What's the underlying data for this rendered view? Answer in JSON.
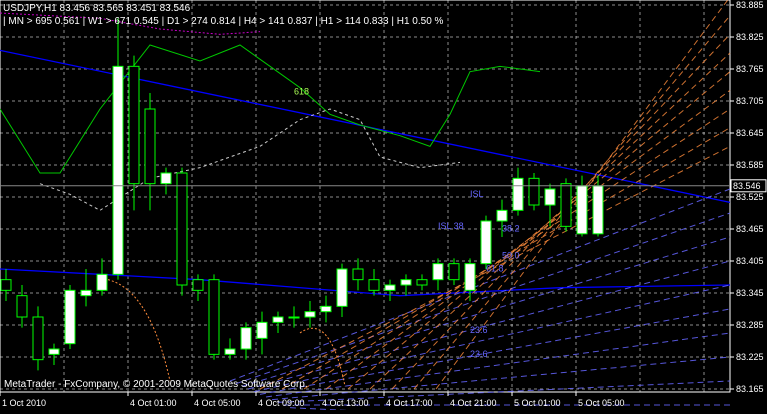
{
  "header": {
    "symbol_line": "USDJPY,H1  83.456 83.565 83.451 83.546",
    "mtf_line": "| MN > 695  0.561 | W1 > 671  0.545 | D1 > 274  0.814 | H4 > 141  0.837 | H1 > 114  0.833 | H1  0.50 %"
  },
  "footer": {
    "copyright": "MetaTrader - FxCompany, © 2001-2009 MetaQuotes Software Corp."
  },
  "colors": {
    "background": "#000000",
    "grid": "#ffffff",
    "bull_body": "#ffffff",
    "candle_outline": "#00ff00",
    "trend_blue": "#0000ff",
    "fan_blue": "#6666ff",
    "fan_orange": "#ff8c3c",
    "green_line": "#00c800",
    "white_dashed": "#ffffff",
    "magenta": "#c800c8",
    "price_label_bg": "#000000"
  },
  "chart_data": {
    "type": "candlestick",
    "symbol": "USDJPY",
    "timeframe": "H1",
    "y_ticks": [
      "83.885",
      "83.825",
      "83.765",
      "83.705",
      "83.645",
      "83.585",
      "83.525",
      "83.465",
      "83.405",
      "83.345",
      "83.285",
      "83.225",
      "83.165"
    ],
    "ylim": [
      83.165,
      83.885
    ],
    "current_price": "83.546",
    "x_ticks": [
      {
        "label": "1 Oct 2010",
        "i": 0
      },
      {
        "label": "4 Oct 01:00",
        "i": 8
      },
      {
        "label": "4 Oct 05:00",
        "i": 12
      },
      {
        "label": "4 Oct 09:00",
        "i": 16
      },
      {
        "label": "4 Oct 13:00",
        "i": 20
      },
      {
        "label": "4 Oct 17:00",
        "i": 24
      },
      {
        "label": "4 Oct 21:00",
        "i": 28
      },
      {
        "label": "5 Oct 01:00",
        "i": 32
      },
      {
        "label": "5 Oct 05:00",
        "i": 36
      }
    ],
    "candles": [
      {
        "o": 83.37,
        "h": 83.39,
        "l": 83.33,
        "c": 83.35
      },
      {
        "o": 83.34,
        "h": 83.36,
        "l": 83.28,
        "c": 83.3
      },
      {
        "o": 83.3,
        "h": 83.32,
        "l": 83.2,
        "c": 83.22
      },
      {
        "o": 83.23,
        "h": 83.25,
        "l": 83.21,
        "c": 83.24
      },
      {
        "o": 83.25,
        "h": 83.36,
        "l": 83.24,
        "c": 83.35
      },
      {
        "o": 83.34,
        "h": 83.39,
        "l": 83.32,
        "c": 83.35
      },
      {
        "o": 83.35,
        "h": 83.41,
        "l": 83.34,
        "c": 83.38
      },
      {
        "o": 83.38,
        "h": 83.86,
        "l": 83.37,
        "c": 83.77
      },
      {
        "o": 83.77,
        "h": 83.79,
        "l": 83.5,
        "c": 83.55
      },
      {
        "o": 83.69,
        "h": 83.72,
        "l": 83.5,
        "c": 83.55
      },
      {
        "o": 83.55,
        "h": 83.58,
        "l": 83.53,
        "c": 83.57
      },
      {
        "o": 83.57,
        "h": 83.58,
        "l": 83.34,
        "c": 83.36
      },
      {
        "o": 83.37,
        "h": 83.38,
        "l": 83.33,
        "c": 83.35
      },
      {
        "o": 83.37,
        "h": 83.38,
        "l": 83.22,
        "c": 83.23
      },
      {
        "o": 83.23,
        "h": 83.26,
        "l": 83.22,
        "c": 83.24
      },
      {
        "o": 83.24,
        "h": 83.29,
        "l": 83.22,
        "c": 83.28
      },
      {
        "o": 83.26,
        "h": 83.31,
        "l": 83.23,
        "c": 83.29
      },
      {
        "o": 83.29,
        "h": 83.31,
        "l": 83.27,
        "c": 83.3
      },
      {
        "o": 83.3,
        "h": 83.32,
        "l": 83.28,
        "c": 83.3
      },
      {
        "o": 83.3,
        "h": 83.33,
        "l": 83.28,
        "c": 83.31
      },
      {
        "o": 83.31,
        "h": 83.34,
        "l": 83.29,
        "c": 83.32
      },
      {
        "o": 83.32,
        "h": 83.4,
        "l": 83.3,
        "c": 83.39
      },
      {
        "o": 83.39,
        "h": 83.41,
        "l": 83.35,
        "c": 83.37
      },
      {
        "o": 83.37,
        "h": 83.39,
        "l": 83.34,
        "c": 83.35
      },
      {
        "o": 83.35,
        "h": 83.37,
        "l": 83.33,
        "c": 83.36
      },
      {
        "o": 83.36,
        "h": 83.38,
        "l": 83.34,
        "c": 83.37
      },
      {
        "o": 83.37,
        "h": 83.38,
        "l": 83.35,
        "c": 83.36
      },
      {
        "o": 83.37,
        "h": 83.41,
        "l": 83.35,
        "c": 83.4
      },
      {
        "o": 83.4,
        "h": 83.41,
        "l": 83.36,
        "c": 83.37
      },
      {
        "o": 83.35,
        "h": 83.41,
        "l": 83.33,
        "c": 83.4
      },
      {
        "o": 83.4,
        "h": 83.49,
        "l": 83.39,
        "c": 83.48
      },
      {
        "o": 83.48,
        "h": 83.52,
        "l": 83.45,
        "c": 83.5
      },
      {
        "o": 83.5,
        "h": 83.58,
        "l": 83.49,
        "c": 83.56
      },
      {
        "o": 83.56,
        "h": 83.57,
        "l": 83.5,
        "c": 83.51
      },
      {
        "o": 83.51,
        "h": 83.55,
        "l": 83.47,
        "c": 83.54
      },
      {
        "o": 83.55,
        "h": 83.56,
        "l": 83.46,
        "c": 83.47
      },
      {
        "o": 83.456,
        "h": 83.565,
        "l": 83.451,
        "c": 83.546
      },
      {
        "o": 83.456,
        "h": 83.565,
        "l": 83.451,
        "c": 83.546
      }
    ],
    "annotations": [
      {
        "text": "618",
        "x_index": 18,
        "y": 83.717
      },
      {
        "text": "ISL",
        "x_index": 29,
        "y": 83.525
      },
      {
        "text": "ISL 38",
        "x_index": 27,
        "y": 83.465
      },
      {
        "text": "61.8",
        "x_index": 30,
        "y": 83.385
      },
      {
        "text": "50.0",
        "x_index": 31,
        "y": 83.41
      },
      {
        "text": "38.2",
        "x_index": 31,
        "y": 83.46
      },
      {
        "text": "23.6",
        "x_index": 29,
        "y": 83.27
      },
      {
        "text": "23.6",
        "x_index": 29,
        "y": 83.225
      }
    ]
  }
}
